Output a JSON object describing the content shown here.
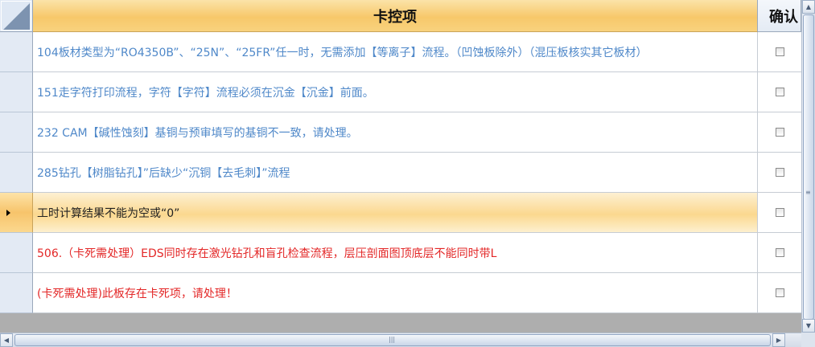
{
  "header": {
    "main_column": "卡控项",
    "confirm_column": "确认"
  },
  "colors": {
    "blue_text": "#4f88c9",
    "red_text": "#e32727",
    "dark_text": "#222222",
    "selected_row": "#f7c46b"
  },
  "rows": [
    {
      "text": "104板材类型为“RO4350B”、“25N”、“25FR”任一时，无需添加【等离子】流程。（凹蚀板除外）（混压板核实其它板材）",
      "color": "#4f88c9",
      "checked": false
    },
    {
      "text": "151走字符打印流程，字符【字符】流程必须在沉金【沉金】前面。",
      "color": "#4f88c9",
      "checked": false
    },
    {
      "text": "232 CAM【碱性蚀刻】基铜与预审填写的基铜不一致，请处理。",
      "color": "#4f88c9",
      "checked": false
    },
    {
      "text": "285钻孔【树脂钻孔】”后缺少“沉铜【去毛刺】”流程",
      "color": "#4f88c9",
      "checked": false
    },
    {
      "text": "工时计算结果不能为空或“0”",
      "color": "#222222",
      "checked": false,
      "selected": true
    },
    {
      "text": "506.（卡死需处理）EDS同时存在激光钻孔和盲孔检查流程，层压剖面图顶底层不能同时带L",
      "color": "#e32727",
      "checked": false
    },
    {
      "text": "(卡死需处理)此板存在卡死项，请处理！",
      "color": "#e32727",
      "checked": false
    }
  ],
  "icons": {
    "row_selector": "arrow-right-icon",
    "scroll_left": "chevron-left-icon",
    "scroll_right": "chevron-right-icon",
    "scroll_up": "chevron-up-icon",
    "scroll_down": "chevron-down-icon"
  }
}
